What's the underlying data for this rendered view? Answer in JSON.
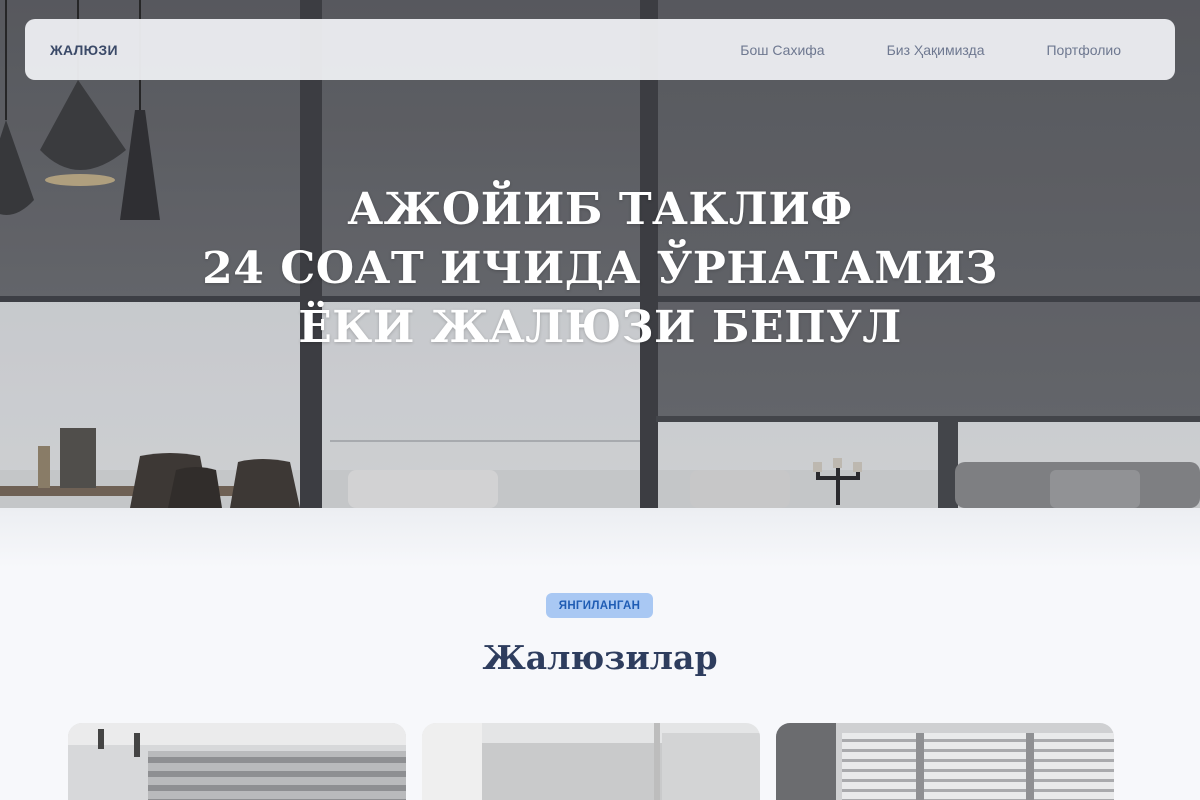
{
  "navbar": {
    "brand": "ЖАЛЮЗИ",
    "links": [
      {
        "label": "Бош Сахифа"
      },
      {
        "label": "Биз Ҳақимизда"
      },
      {
        "label": "Портфолио"
      }
    ]
  },
  "hero": {
    "lines": [
      "АЖОЙИБ ТАКЛИФ",
      "24 СОАТ ИЧИДА ЎРНАТАМИЗ",
      "ЁКИ ЖАЛЮЗИ БЕПУЛ"
    ]
  },
  "section": {
    "badge": "ЯНГИЛАНГАН",
    "title": "Жалюзилар"
  },
  "colors": {
    "brand_text": "#3b4a68",
    "badge_bg": "#a9c8f3",
    "badge_text": "#1f5cb4",
    "title_text": "#2e3d5e"
  }
}
